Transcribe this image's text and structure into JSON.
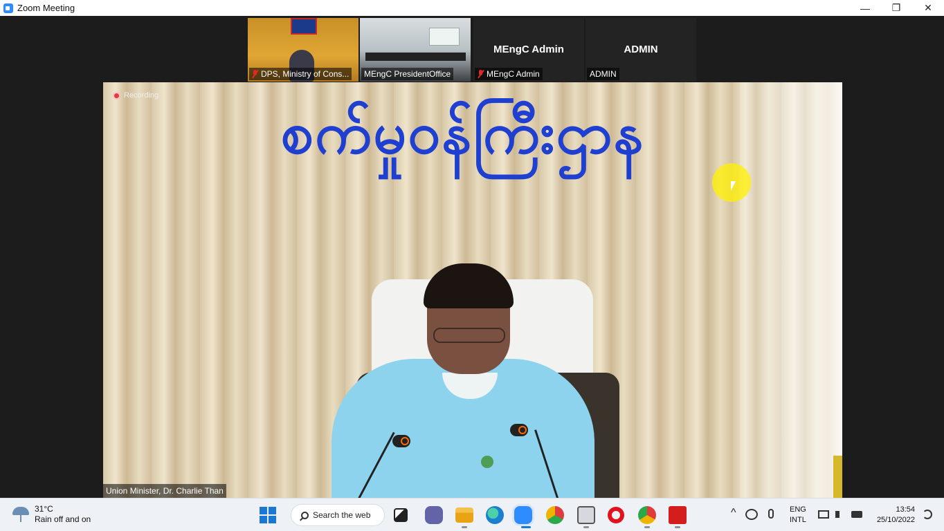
{
  "window": {
    "title": "Zoom Meeting",
    "minimize_glyph": "—",
    "restore_glyph": "❐",
    "close_glyph": "✕"
  },
  "participants": [
    {
      "name": "DPS, Ministry of Cons...",
      "muted": true
    },
    {
      "name": "MEngC PresidentOffice",
      "muted": false
    },
    {
      "name": "MEngC Admin",
      "muted": true,
      "video": false
    },
    {
      "name": "ADMIN",
      "muted": false,
      "video": false
    }
  ],
  "main_video": {
    "recording_label": "Recording",
    "banner_text": "စက်မှုဝန်ကြီးဌာန",
    "speaker_label": "Union Minister, Dr. Charlie Than"
  },
  "taskbar": {
    "weather_temp": "31°C",
    "weather_desc": "Rain off and on",
    "search_label": "Search the web",
    "lang_top": "ENG",
    "lang_bottom": "INTL",
    "time": "13:54",
    "date": "25/10/2022",
    "chevron_glyph": "^",
    "pinned_icons": [
      "task-view-icon",
      "teams-chat-icon",
      "file-explorer-icon",
      "edge-icon",
      "zoom-icon",
      "app-icon",
      "network-drive-icon",
      "opera-icon",
      "chrome-icon",
      "acrobat-icon"
    ]
  },
  "colors": {
    "banner_blue": "#1e3fd0",
    "recording_red": "#e23b3b",
    "muted_red": "#e02828",
    "zoom_blue": "#2d8cff",
    "cursor_highlight": "#fff000"
  }
}
